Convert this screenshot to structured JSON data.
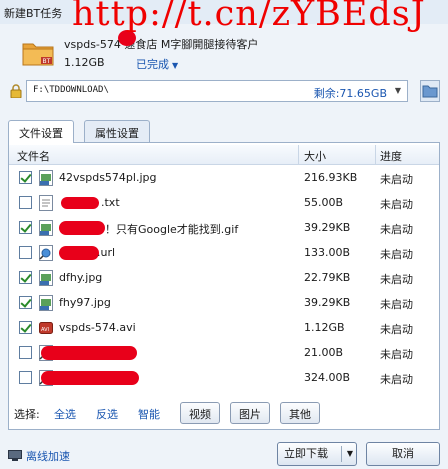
{
  "window": {
    "title": "新建BT任务",
    "watermark": "http://t.cn/zYBEdsJ"
  },
  "task": {
    "name": "vspds-574 速食店 M字腳開腿接待客户",
    "size": "1.12GB",
    "status": "已完成"
  },
  "path": {
    "value": "F:\\TDDOWNLOAD\\",
    "free_space": "剩余:71.65GB"
  },
  "tabs": [
    {
      "label": "文件设置"
    },
    {
      "label": "属性设置"
    }
  ],
  "table": {
    "headers": {
      "name": "文件名",
      "size": "大小",
      "status": "进度"
    },
    "rows": [
      {
        "checked": true,
        "type": "jpg",
        "name": "42vspds574pl.jpg",
        "size": "216.93KB",
        "status": "未启动"
      },
      {
        "checked": false,
        "type": "txt",
        "name": ".txt",
        "size": "55.00B",
        "status": "未启动"
      },
      {
        "checked": true,
        "type": "gif",
        "name": "！只有Google才能找到.gif",
        "size": "39.29KB",
        "status": "未启动"
      },
      {
        "checked": false,
        "type": "url",
        "name": ".url",
        "size": "133.00B",
        "status": "未启动"
      },
      {
        "checked": true,
        "type": "jpg",
        "name": "dfhy.jpg",
        "size": "22.79KB",
        "status": "未启动"
      },
      {
        "checked": true,
        "type": "jpg",
        "name": "fhy97.jpg",
        "size": "39.29KB",
        "status": "未启动"
      },
      {
        "checked": true,
        "type": "avi",
        "name": "vspds-574.avi",
        "size": "1.12GB",
        "status": "未启动"
      },
      {
        "checked": false,
        "type": "url",
        "name": "",
        "size": "21.00B",
        "status": "未启动"
      },
      {
        "checked": false,
        "type": "url",
        "name": "",
        "size": "324.00B",
        "status": "未启动"
      }
    ]
  },
  "filter": {
    "label": "选择:",
    "links": [
      "全选",
      "反选",
      "智能"
    ],
    "buttons": [
      "视频",
      "图片",
      "其他"
    ]
  },
  "footer": {
    "offline": "离线加速",
    "download": "立即下载",
    "cancel": "取消"
  },
  "colors": {
    "link": "#1a56b0",
    "watermark": "#f00000",
    "scribble": "#e8001a",
    "background": "#eef3f9"
  }
}
